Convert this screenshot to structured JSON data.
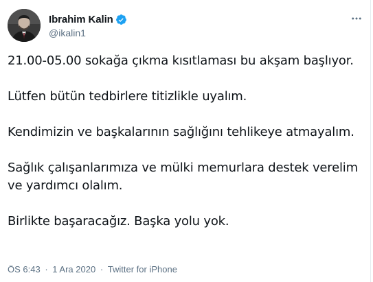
{
  "author": {
    "display_name": "Ibrahim Kalin",
    "handle": "@ikalin1",
    "verified": true
  },
  "tweet": {
    "paragraphs": [
      "21.00-05.00 sokağa çıkma kısıtlaması bu akşam başlıyor.",
      "Lütfen bütün tedbirlere titizlikle uyalım.",
      "Kendimizin ve başkalarının sağlığını tehlikeye atmayalım.",
      "Sağlık çalışanlarımıza ve mülki memurlara destek verelim ve yardımcı olalım.",
      "Birlikte başaracağız. Başka yolu yok."
    ],
    "time": "ÖS 6:43",
    "separator": "·",
    "date": "1 Ara 2020",
    "source": "Twitter for iPhone"
  },
  "icons": {
    "verified": "verified-badge-icon",
    "more": "more-options-icon"
  },
  "colors": {
    "accent": "#1da1f2",
    "text": "#0f1419",
    "secondary": "#5b7083"
  }
}
